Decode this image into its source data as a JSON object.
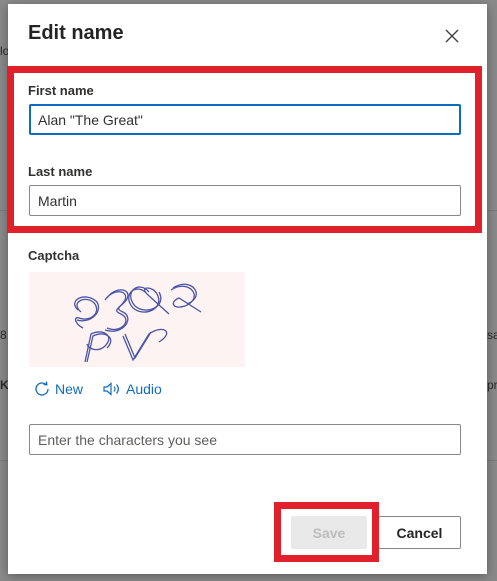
{
  "dialog": {
    "title": "Edit name",
    "first_name": {
      "label": "First name",
      "value": "Alan \"The Great\""
    },
    "last_name": {
      "label": "Last name",
      "value": "Martin"
    },
    "captcha": {
      "label": "Captcha",
      "new_label": "New",
      "audio_label": "Audio",
      "input_placeholder": "Enter the characters you see"
    },
    "buttons": {
      "save": "Save",
      "cancel": "Cancel"
    }
  },
  "background_fragments": {
    "left_a": "8",
    "left_b": "K",
    "right_a": "sa",
    "right_b": "pr",
    "left_top": "lo"
  },
  "colors": {
    "accent": "#0f6cbd",
    "highlight": "#e0202a",
    "overlay": "#8a8a8a"
  }
}
